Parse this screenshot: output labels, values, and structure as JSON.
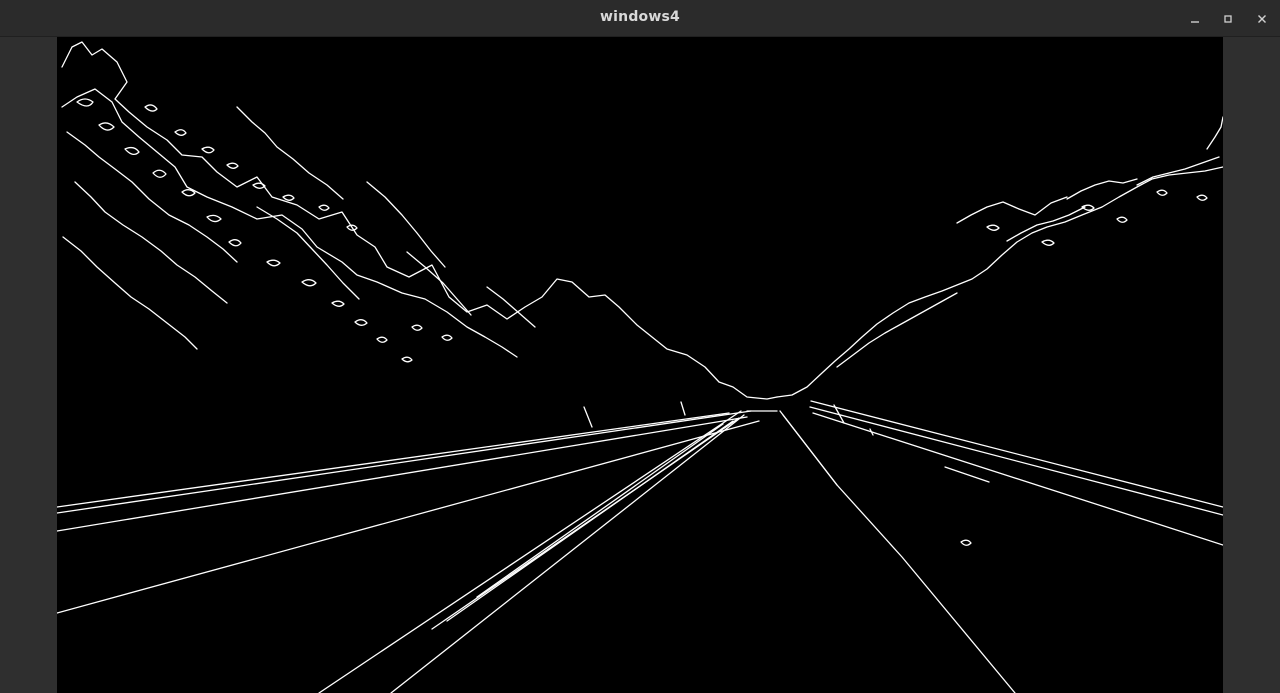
{
  "window": {
    "title": "windows4"
  },
  "controls": {
    "minimize_icon": "minimize-icon",
    "maximize_icon": "maximize-icon",
    "close_icon": "close-icon"
  },
  "image": {
    "description_type": "edge-detected road scene",
    "background_color": "#000000",
    "edge_color": "#ffffff"
  }
}
